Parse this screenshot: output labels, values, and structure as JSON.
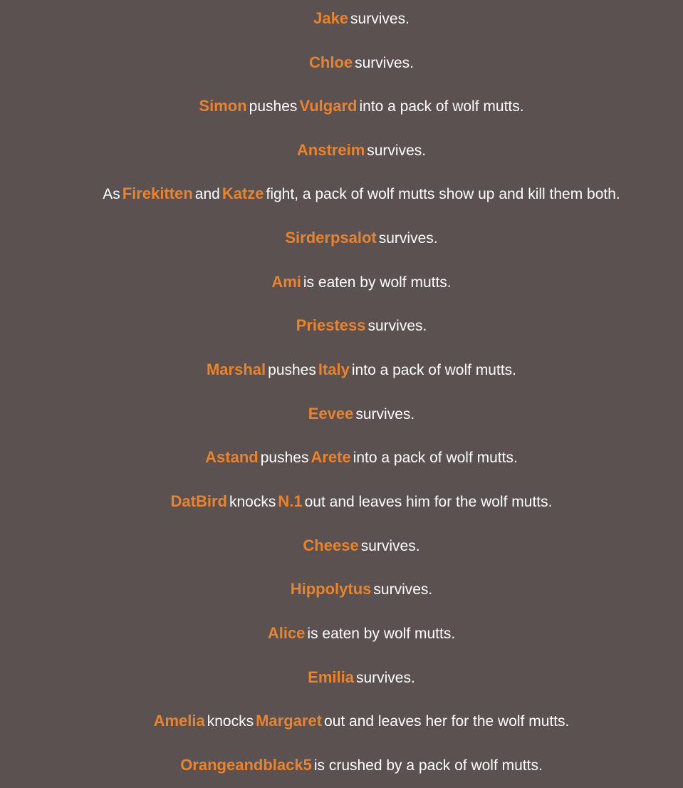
{
  "theme": {
    "background": "#5b5150",
    "name_color": "#e8832e",
    "text_color": "#ffffff"
  },
  "events": [
    {
      "parts": [
        {
          "t": "name",
          "v": "Jake"
        },
        {
          "t": "text",
          "v": "survives."
        }
      ]
    },
    {
      "parts": [
        {
          "t": "name",
          "v": "Chloe"
        },
        {
          "t": "text",
          "v": "survives."
        }
      ]
    },
    {
      "parts": [
        {
          "t": "name",
          "v": "Simon"
        },
        {
          "t": "text",
          "v": "pushes"
        },
        {
          "t": "name",
          "v": "Vulgard"
        },
        {
          "t": "text",
          "v": "into a pack of wolf mutts."
        }
      ]
    },
    {
      "parts": [
        {
          "t": "name",
          "v": "Anstreim"
        },
        {
          "t": "text",
          "v": "survives."
        }
      ]
    },
    {
      "parts": [
        {
          "t": "text",
          "v": "As"
        },
        {
          "t": "name",
          "v": "Firekitten"
        },
        {
          "t": "text",
          "v": "and"
        },
        {
          "t": "name",
          "v": "Katze"
        },
        {
          "t": "text",
          "v": "fight, a pack of wolf mutts show up and kill them both."
        }
      ]
    },
    {
      "parts": [
        {
          "t": "name",
          "v": "Sirderpsalot"
        },
        {
          "t": "text",
          "v": "survives."
        }
      ]
    },
    {
      "parts": [
        {
          "t": "name",
          "v": "Ami"
        },
        {
          "t": "text",
          "v": "is eaten by wolf mutts."
        }
      ]
    },
    {
      "parts": [
        {
          "t": "name",
          "v": "Priestess"
        },
        {
          "t": "text",
          "v": "survives."
        }
      ]
    },
    {
      "parts": [
        {
          "t": "name",
          "v": "Marshal"
        },
        {
          "t": "text",
          "v": "pushes"
        },
        {
          "t": "name",
          "v": "Italy"
        },
        {
          "t": "text",
          "v": "into a pack of wolf mutts."
        }
      ]
    },
    {
      "parts": [
        {
          "t": "name",
          "v": "Eevee"
        },
        {
          "t": "text",
          "v": "survives."
        }
      ]
    },
    {
      "parts": [
        {
          "t": "name",
          "v": "Astand"
        },
        {
          "t": "text",
          "v": "pushes"
        },
        {
          "t": "name",
          "v": "Arete"
        },
        {
          "t": "text",
          "v": "into a pack of wolf mutts."
        }
      ]
    },
    {
      "parts": [
        {
          "t": "name",
          "v": "DatBird"
        },
        {
          "t": "text",
          "v": "knocks"
        },
        {
          "t": "name",
          "v": "N.1"
        },
        {
          "t": "text",
          "v": "out and leaves him for the wolf mutts."
        }
      ]
    },
    {
      "parts": [
        {
          "t": "name",
          "v": "Cheese"
        },
        {
          "t": "text",
          "v": "survives."
        }
      ]
    },
    {
      "parts": [
        {
          "t": "name",
          "v": "Hippolytus"
        },
        {
          "t": "text",
          "v": "survives."
        }
      ]
    },
    {
      "parts": [
        {
          "t": "name",
          "v": "Alice"
        },
        {
          "t": "text",
          "v": "is eaten by wolf mutts."
        }
      ]
    },
    {
      "parts": [
        {
          "t": "name",
          "v": "Emilia"
        },
        {
          "t": "text",
          "v": "survives."
        }
      ]
    },
    {
      "parts": [
        {
          "t": "name",
          "v": "Amelia"
        },
        {
          "t": "text",
          "v": "knocks"
        },
        {
          "t": "name",
          "v": "Margaret"
        },
        {
          "t": "text",
          "v": "out and leaves her for the wolf mutts."
        }
      ]
    },
    {
      "parts": [
        {
          "t": "name",
          "v": "Orangeandblack5"
        },
        {
          "t": "text",
          "v": "is crushed by a pack of wolf mutts."
        }
      ]
    }
  ]
}
